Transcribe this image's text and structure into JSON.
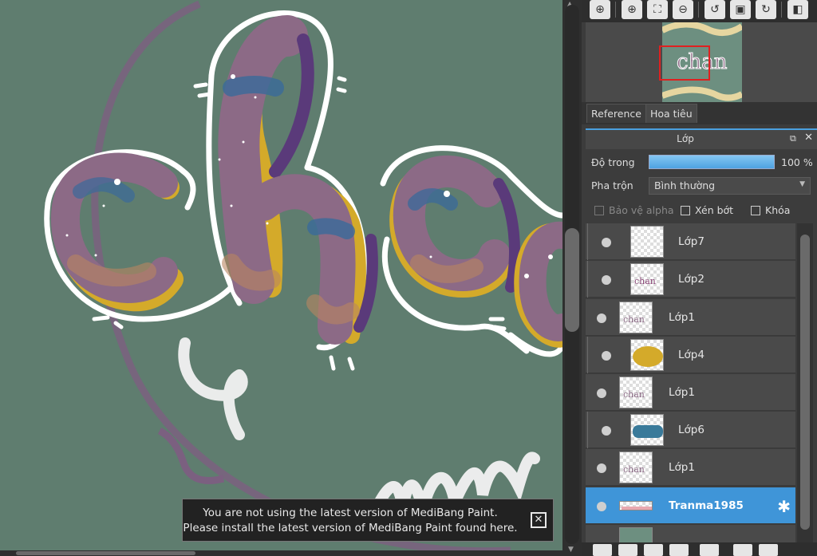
{
  "navigator_tabs": {
    "reference": "Reference",
    "navigator": "Hoa tiêu"
  },
  "layer_panel": {
    "title": "Lớp",
    "opacity_label": "Độ trong",
    "opacity_value": "100 %",
    "opacity_level": 1.0,
    "blend_label": "Pha trộn",
    "blend_value": "Bình thường",
    "protect_alpha": "Bảo vệ alpha",
    "clipping": "Xén bớt",
    "lock": "Khóa"
  },
  "layers": [
    {
      "name": "Lớp7",
      "child": true,
      "selected": false,
      "thumb": "empty"
    },
    {
      "name": "Lớp2",
      "child": true,
      "selected": false,
      "thumb": "lettering"
    },
    {
      "name": "Lớp1",
      "child": false,
      "selected": false,
      "thumb": "lettering"
    },
    {
      "name": "Lớp4",
      "child": true,
      "selected": false,
      "thumb": "yellow-blob"
    },
    {
      "name": "Lớp1",
      "child": false,
      "selected": false,
      "thumb": "lettering"
    },
    {
      "name": "Lớp6",
      "child": true,
      "selected": false,
      "thumb": "blue-blob"
    },
    {
      "name": "Lớp1",
      "child": false,
      "selected": false,
      "thumb": "lettering"
    },
    {
      "name": "Tranma1985",
      "child": false,
      "selected": true,
      "thumb": "pink-strip"
    }
  ],
  "notification": {
    "line1": "You are not using the latest version of MediBang Paint.",
    "line2": "Please install the latest version of MediBang Paint found here."
  },
  "colors": {
    "canvas_bg": "#5f7d6f",
    "accent": "#3f95d8",
    "letter_fill": "#8c6a86",
    "letter_yellow": "#d4aa2a",
    "letter_purple": "#5a3a7a",
    "letter_blue": "#3a6a9a"
  }
}
